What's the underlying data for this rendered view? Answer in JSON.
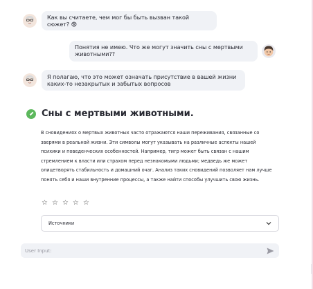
{
  "chat": {
    "messages": [
      {
        "role": "assistant",
        "text": "Как вы считаете, чем мог бы быть вызван такой сюжет? 😨"
      },
      {
        "role": "user",
        "text": "Понятия не имею. Что же могут значить сны с мертвыми животными??"
      },
      {
        "role": "assistant",
        "text": "Я полагаю, что это может означать присутствие в вашей жизни каких-то незакрытых и забытых вопросов"
      }
    ]
  },
  "article": {
    "title": "Сны с мертвыми животными.",
    "icon": "pencil-icon",
    "body": "В сновидениях о мертвых животных часто отражаются наши переживания, связанные со зверями в реальной жизни. Эти символы могут указывать на различные аспекты нашей психики и поведенческих особенностей. Например, тигр может быть связан с нашим стремлением к власти или страхом перед незнакомыми людьми; медведь же может олицетворять стабильность и домашний очаг. Анализ таких сновидений позволяет нам лучше понять себя и наши внутренние процессы, а также найти способы улучшить свою жизнь."
  },
  "rating": {
    "max": 5,
    "value": 0,
    "glyph": "☆"
  },
  "sources": {
    "label": "Источники",
    "chevron": "chevron-down-icon"
  },
  "input": {
    "placeholder": "User Input:",
    "value": ""
  },
  "colors": {
    "bubble_bg": "#f0f2f6",
    "icon_green": "#5cb85c",
    "text": "#262730"
  }
}
